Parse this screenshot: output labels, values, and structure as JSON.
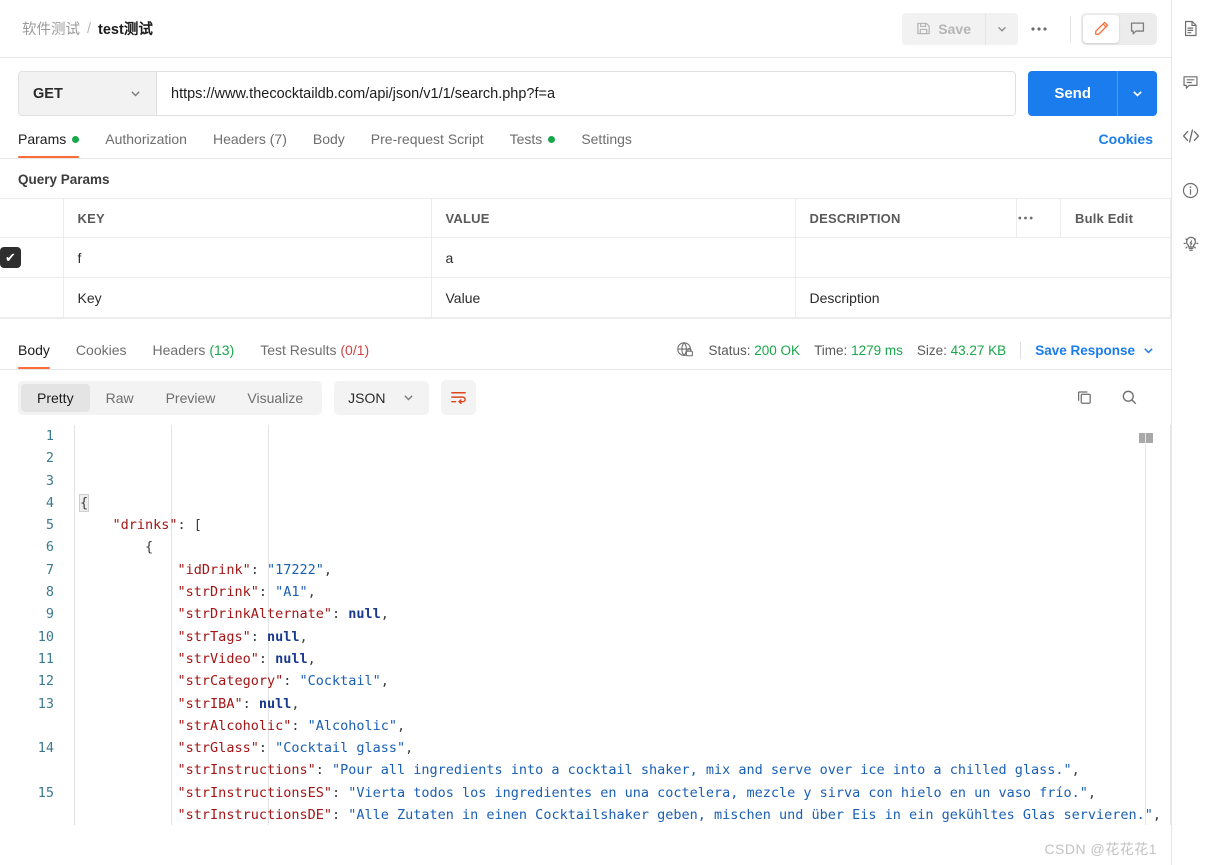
{
  "header": {
    "breadcrumb": {
      "collection": "软件测试",
      "separator": "/",
      "request": "test测试"
    },
    "save_label": "Save",
    "more_label": "000",
    "edit_icon": "pencil-icon",
    "comment_icon": "comment-icon"
  },
  "url_bar": {
    "method": "GET",
    "url": "https://www.thecocktaildb.com/api/json/v1/1/search.php?f=a",
    "send_label": "Send"
  },
  "request_tabs": [
    {
      "label": "Params",
      "dot": true,
      "active": true
    },
    {
      "label": "Authorization",
      "dot": false,
      "active": false
    },
    {
      "label": "Headers (7)",
      "dot": false,
      "active": false
    },
    {
      "label": "Body",
      "dot": false,
      "active": false
    },
    {
      "label": "Pre-request Script",
      "dot": false,
      "active": false
    },
    {
      "label": "Tests",
      "dot": true,
      "active": false
    },
    {
      "label": "Settings",
      "dot": false,
      "active": false
    }
  ],
  "cookies_link": "Cookies",
  "query_params": {
    "title": "Query Params",
    "columns": {
      "key": "KEY",
      "value": "VALUE",
      "description": "DESCRIPTION",
      "more": "000",
      "bulk_edit": "Bulk Edit"
    },
    "rows": [
      {
        "checked": true,
        "key": "f",
        "value": "a",
        "description": ""
      }
    ],
    "placeholder_row": {
      "key": "Key",
      "value": "Value",
      "description": "Description"
    }
  },
  "response": {
    "tabs": [
      {
        "label": "Body",
        "count": "",
        "active": true
      },
      {
        "label": "Cookies",
        "count": "",
        "active": false
      },
      {
        "label": "Headers",
        "count": "(13)",
        "count_color": "green",
        "active": false
      },
      {
        "label": "Test Results",
        "count": "(0/1)",
        "count_color": "red",
        "active": false
      }
    ],
    "meta": {
      "status_label": "Status:",
      "status_value": "200 OK",
      "time_label": "Time:",
      "time_value": "1279 ms",
      "size_label": "Size:",
      "size_value": "43.27 KB",
      "save_response": "Save Response"
    },
    "viewer": {
      "modes": [
        "Pretty",
        "Raw",
        "Preview",
        "Visualize"
      ],
      "active_mode": "Pretty",
      "format": "JSON",
      "wrap_icon": "word-wrap-icon",
      "copy_icon": "copy-icon",
      "search_icon": "search-icon"
    },
    "code_lines": [
      {
        "n": "1",
        "tokens": [
          {
            "t": "brace-hl p",
            "v": "{"
          }
        ]
      },
      {
        "n": "2",
        "tokens": [
          {
            "t": "p",
            "v": "    "
          },
          {
            "t": "k",
            "v": "\"drinks\""
          },
          {
            "t": "p",
            "v": ": ["
          }
        ]
      },
      {
        "n": "3",
        "tokens": [
          {
            "t": "p",
            "v": "        {"
          }
        ]
      },
      {
        "n": "4",
        "tokens": [
          {
            "t": "p",
            "v": "            "
          },
          {
            "t": "k",
            "v": "\"idDrink\""
          },
          {
            "t": "p",
            "v": ": "
          },
          {
            "t": "s",
            "v": "\"17222\""
          },
          {
            "t": "p",
            "v": ","
          }
        ]
      },
      {
        "n": "5",
        "tokens": [
          {
            "t": "p",
            "v": "            "
          },
          {
            "t": "k",
            "v": "\"strDrink\""
          },
          {
            "t": "p",
            "v": ": "
          },
          {
            "t": "s",
            "v": "\"A1\""
          },
          {
            "t": "p",
            "v": ","
          }
        ]
      },
      {
        "n": "6",
        "tokens": [
          {
            "t": "p",
            "v": "            "
          },
          {
            "t": "k",
            "v": "\"strDrinkAlternate\""
          },
          {
            "t": "p",
            "v": ": "
          },
          {
            "t": "n",
            "v": "null"
          },
          {
            "t": "p",
            "v": ","
          }
        ]
      },
      {
        "n": "7",
        "tokens": [
          {
            "t": "p",
            "v": "            "
          },
          {
            "t": "k",
            "v": "\"strTags\""
          },
          {
            "t": "p",
            "v": ": "
          },
          {
            "t": "n",
            "v": "null"
          },
          {
            "t": "p",
            "v": ","
          }
        ]
      },
      {
        "n": "8",
        "tokens": [
          {
            "t": "p",
            "v": "            "
          },
          {
            "t": "k",
            "v": "\"strVideo\""
          },
          {
            "t": "p",
            "v": ": "
          },
          {
            "t": "n",
            "v": "null"
          },
          {
            "t": "p",
            "v": ","
          }
        ]
      },
      {
        "n": "9",
        "tokens": [
          {
            "t": "p",
            "v": "            "
          },
          {
            "t": "k",
            "v": "\"strCategory\""
          },
          {
            "t": "p",
            "v": ": "
          },
          {
            "t": "s",
            "v": "\"Cocktail\""
          },
          {
            "t": "p",
            "v": ","
          }
        ]
      },
      {
        "n": "10",
        "tokens": [
          {
            "t": "p",
            "v": "            "
          },
          {
            "t": "k",
            "v": "\"strIBA\""
          },
          {
            "t": "p",
            "v": ": "
          },
          {
            "t": "n",
            "v": "null"
          },
          {
            "t": "p",
            "v": ","
          }
        ]
      },
      {
        "n": "11",
        "tokens": [
          {
            "t": "p",
            "v": "            "
          },
          {
            "t": "k",
            "v": "\"strAlcoholic\""
          },
          {
            "t": "p",
            "v": ": "
          },
          {
            "t": "s",
            "v": "\"Alcoholic\""
          },
          {
            "t": "p",
            "v": ","
          }
        ]
      },
      {
        "n": "12",
        "tokens": [
          {
            "t": "p",
            "v": "            "
          },
          {
            "t": "k",
            "v": "\"strGlass\""
          },
          {
            "t": "p",
            "v": ": "
          },
          {
            "t": "s",
            "v": "\"Cocktail glass\""
          },
          {
            "t": "p",
            "v": ","
          }
        ]
      },
      {
        "n": "13",
        "tall": true,
        "tokens": [
          {
            "t": "p",
            "v": "            "
          },
          {
            "t": "k",
            "v": "\"strInstructions\""
          },
          {
            "t": "p",
            "v": ": "
          },
          {
            "t": "s",
            "v": "\"Pour all ingredients into a cocktail shaker, mix and serve over ice into a chilled glass.\""
          },
          {
            "t": "p",
            "v": ","
          }
        ]
      },
      {
        "n": "14",
        "tall": true,
        "tokens": [
          {
            "t": "p",
            "v": "            "
          },
          {
            "t": "k",
            "v": "\"strInstructionsES\""
          },
          {
            "t": "p",
            "v": ": "
          },
          {
            "t": "s",
            "v": "\"Vierta todos los ingredientes en una coctelera, mezcle y sirva con hielo en un vaso frío.\""
          },
          {
            "t": "p",
            "v": ","
          }
        ]
      },
      {
        "n": "15",
        "tall": true,
        "tokens": [
          {
            "t": "p",
            "v": "            "
          },
          {
            "t": "k",
            "v": "\"strInstructionsDE\""
          },
          {
            "t": "p",
            "v": ": "
          },
          {
            "t": "s",
            "v": "\"Alle Zutaten in einen Cocktailshaker geben, mischen und über Eis in ein gekühltes Glas servieren.\""
          },
          {
            "t": "p",
            "v": ","
          }
        ]
      }
    ]
  },
  "right_rail": [
    {
      "icon": "document-icon"
    },
    {
      "icon": "comment-icon"
    },
    {
      "icon": "code-icon"
    },
    {
      "icon": "info-icon"
    },
    {
      "icon": "lightbulb-icon"
    }
  ],
  "watermark": "CSDN @花花花1",
  "colors": {
    "accent": "#ff6c37",
    "send": "#1a7ced",
    "success": "#1aa64b",
    "error": "#d14343"
  }
}
